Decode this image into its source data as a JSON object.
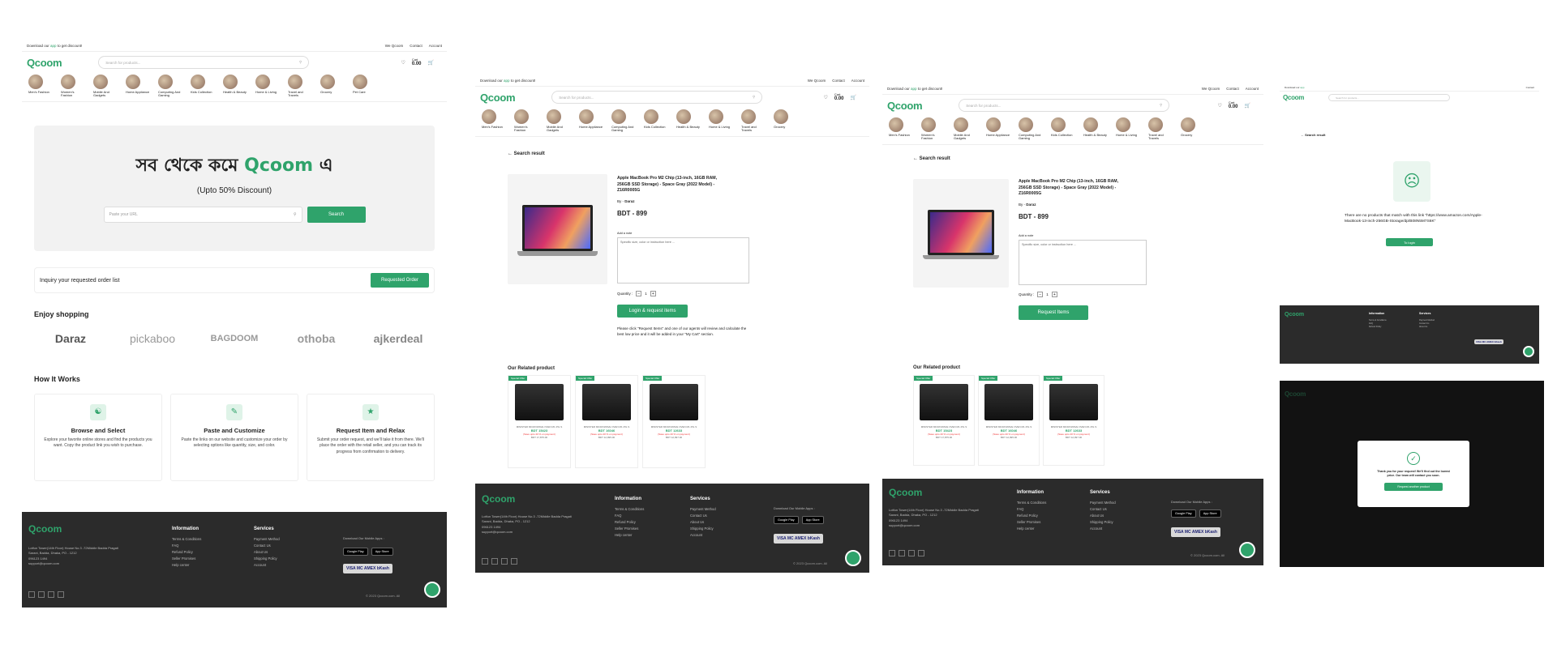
{
  "topbar": {
    "promo_prefix": "Download our",
    "promo_app": "app",
    "promo_suffix": "to get discount!",
    "links": [
      "We Qcoom",
      "Contact",
      "Account"
    ]
  },
  "header": {
    "logo": "Qcoom",
    "search_placeholder": "Search for products...",
    "cart_label": "Cart",
    "cart_total": "0.00"
  },
  "categories": [
    "Men's Fashion",
    "Women's Fashion",
    "Mobile And Gadgets",
    "Home Appliance",
    "Computing And Gaming",
    "Kids Collection",
    "Health & Beauty",
    "Home & Living",
    "Travel and Travels",
    "Grocery",
    "Pet Care"
  ],
  "hero": {
    "title_prefix": "সব থেকে কমে",
    "title_brand": "Qcoom",
    "title_suffix": "এ",
    "subtitle": "(Upto 50% Discount)",
    "url_placeholder": "Paste your URL",
    "search_button": "Search"
  },
  "inquiry": {
    "text": "Inquiry your requested order list",
    "button": "Requested Order"
  },
  "enjoy": {
    "title": "Enjoy shopping",
    "shops": [
      "Daraz",
      "pickaboo",
      "BAGDOOM",
      "othoba",
      "ajkerdeal"
    ]
  },
  "how": {
    "title": "How It Works",
    "steps": [
      {
        "title": "Browse and Select",
        "desc": "Explore your favorite online stores and find the products you want. Copy the product link you wish to purchase."
      },
      {
        "title": "Paste and Customize",
        "desc": "Paste the links on our website and customize your order by selecting options like quantity, size, and color."
      },
      {
        "title": "Request Item and Relax",
        "desc": "Submit your order request, and we'll take it from there. We'll place the order with the retail seller, and you can track its progress from confirmation to delivery."
      }
    ]
  },
  "footer": {
    "logo": "Qcoom",
    "address": "Lotfun Tower(14th Floor) House No.3 -72Middle Badda Pragati Sarani, Badda, Dhaka, PO - 1212",
    "phone": "096123 1494",
    "email": "support@qcoom.com",
    "info_title": "Information",
    "info_links": [
      "Terms & Conditions",
      "FAQ",
      "Refund Policy",
      "Seller Promises",
      "Help center"
    ],
    "serv_title": "Services",
    "serv_links": [
      "Payment Method",
      "Contact Us",
      "About Us",
      "Shipping Policy",
      "Account"
    ],
    "download": "Download Our Mobile Apps :",
    "google": "Google Play",
    "apple": "App Store",
    "pay": "VISA  MC  AMEX  bKash",
    "copyright": "© 2023 Qcoom.com. All"
  },
  "search_result": {
    "back": "Search result",
    "product_title": "Apple MacBook Pro M2 Chip (13-inch, 16GB RAM, 256GB SSD Storage) - Space Gray (2022 Model) - Z16R0005G",
    "by_label": "By -",
    "by_store": "Daraz",
    "price": "BDT - 899",
    "note_label": "Add a note",
    "note_placeholder": "Specific size, color or instruction here ...",
    "qty_label": "Quantity :",
    "qty": "1",
    "login_button": "Login & request items",
    "request_button": "Request Items",
    "info": "Please click \"Request Items\" and one of our agents will review and calculate the best low price and it will be added in your \"My Cart\" section.",
    "related_title": "Our Related product"
  },
  "related": [
    {
      "tag": "Special Offer",
      "name": "MINISTER MICROWAVE OVEN M1 25L S",
      "price": "BDT 15423",
      "save": "(Save upto 20 % on payment)",
      "old": "BDT 17,875.00"
    },
    {
      "tag": "Special Offer",
      "name": "MINISTER MICROWAVE OVEN M1 25L S",
      "price": "BDT 16046",
      "save": "(Save upto 20 % on payment)",
      "old": "BDT 12,995.00"
    },
    {
      "tag": "Special Offer",
      "name": "MINISTER MICROWAVE OVEN M1 25L S",
      "price": "BDT 12633",
      "save": "(Save upto 20 % on payment)",
      "old": "BDT 12,997.00"
    }
  ],
  "empty": {
    "message": "There are no products that match with this link \"https://www.amazon.com/Apple-MacBook-13-inch-256GB-Storage/dp/B08N5M7S6K\"",
    "button": "To login"
  },
  "modal": {
    "message": "Thank you for your request! We'll find out the lowest price. Our team will contact you soon.",
    "button": "Request another product"
  },
  "badge": "We Are Here!"
}
